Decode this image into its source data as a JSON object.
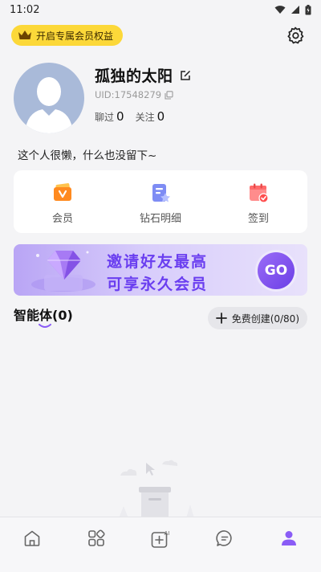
{
  "status_bar": {
    "time": "11:02"
  },
  "vip_banner": {
    "label": "开启专属会员权益"
  },
  "profile": {
    "username": "孤独的太阳",
    "uid": "UID:17548279",
    "chat_label": "聊过",
    "chat_count": "0",
    "follow_label": "关注",
    "follow_count": "0",
    "bio": "这个人很懒，什么也没留下~"
  },
  "quick_actions": [
    {
      "label": "会员",
      "icon": "vip-card-icon"
    },
    {
      "label": "钻石明细",
      "icon": "diamond-detail-icon"
    },
    {
      "label": "签到",
      "icon": "calendar-check-icon"
    }
  ],
  "promo_banner": {
    "line1": "邀请好友最高",
    "line2": "可享永久会员",
    "go": "GO"
  },
  "agents": {
    "title": "智能体(0)",
    "create_label": "免费创建(0/80)"
  },
  "tab_bar": [
    {
      "name": "home",
      "icon": "home-icon",
      "active": false
    },
    {
      "name": "discover",
      "icon": "grid-icon",
      "active": false
    },
    {
      "name": "create-ai",
      "icon": "ai-add-icon",
      "active": false
    },
    {
      "name": "messages",
      "icon": "chat-bubble-icon",
      "active": false
    },
    {
      "name": "profile",
      "icon": "person-icon",
      "active": true
    }
  ],
  "colors": {
    "accent": "#8a5cf6",
    "vip_yellow": "#fcd839",
    "banner_text": "#6a3ef0"
  }
}
